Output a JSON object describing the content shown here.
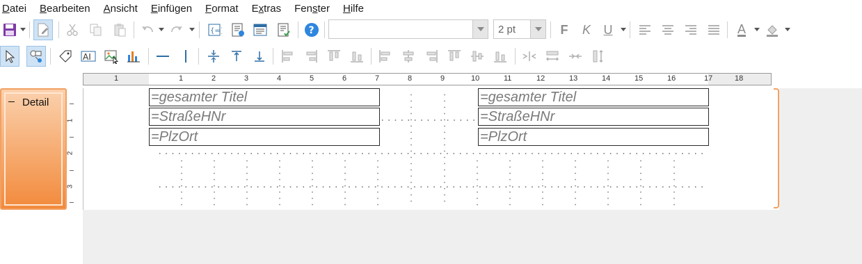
{
  "menu": [
    {
      "label": "Datei",
      "ul": "D"
    },
    {
      "label": "Bearbeiten",
      "ul": "B"
    },
    {
      "label": "Ansicht",
      "ul": "A"
    },
    {
      "label": "Einfügen",
      "ul": "E"
    },
    {
      "label": "Format",
      "ul": "F"
    },
    {
      "label": "Extras",
      "ul": "x"
    },
    {
      "label": "Fenster",
      "ul": "s"
    },
    {
      "label": "Hilfe",
      "ul": "H"
    }
  ],
  "format_toolbar": {
    "font_name": "",
    "line_width": "2 pt",
    "bold_label": "F",
    "italic_label": "K",
    "underline_label": "U",
    "font_color_label": "A"
  },
  "ruler": {
    "labels": [
      "1",
      "1",
      "2",
      "3",
      "4",
      "5",
      "6",
      "7",
      "8",
      "9",
      "10",
      "11",
      "12",
      "13",
      "14",
      "15",
      "16",
      "17",
      "18"
    ]
  },
  "vruler": {
    "labels": [
      "1",
      "2",
      "3"
    ]
  },
  "section": {
    "name": "Detail",
    "collapse_symbol": "−"
  },
  "fields": {
    "left": [
      "=gesamter Titel",
      "=StraßeHNr",
      "=PlzOrt"
    ],
    "right": [
      "=gesamter Titel",
      "=StraßeHNr",
      "=PlzOrt"
    ]
  },
  "colors": {
    "section_accent": "#f28a3c",
    "active_tool": "#cfe3f5",
    "help_icon": "#2e86de",
    "chart_icon_bars": [
      "#2e86de",
      "#e67e22"
    ]
  }
}
